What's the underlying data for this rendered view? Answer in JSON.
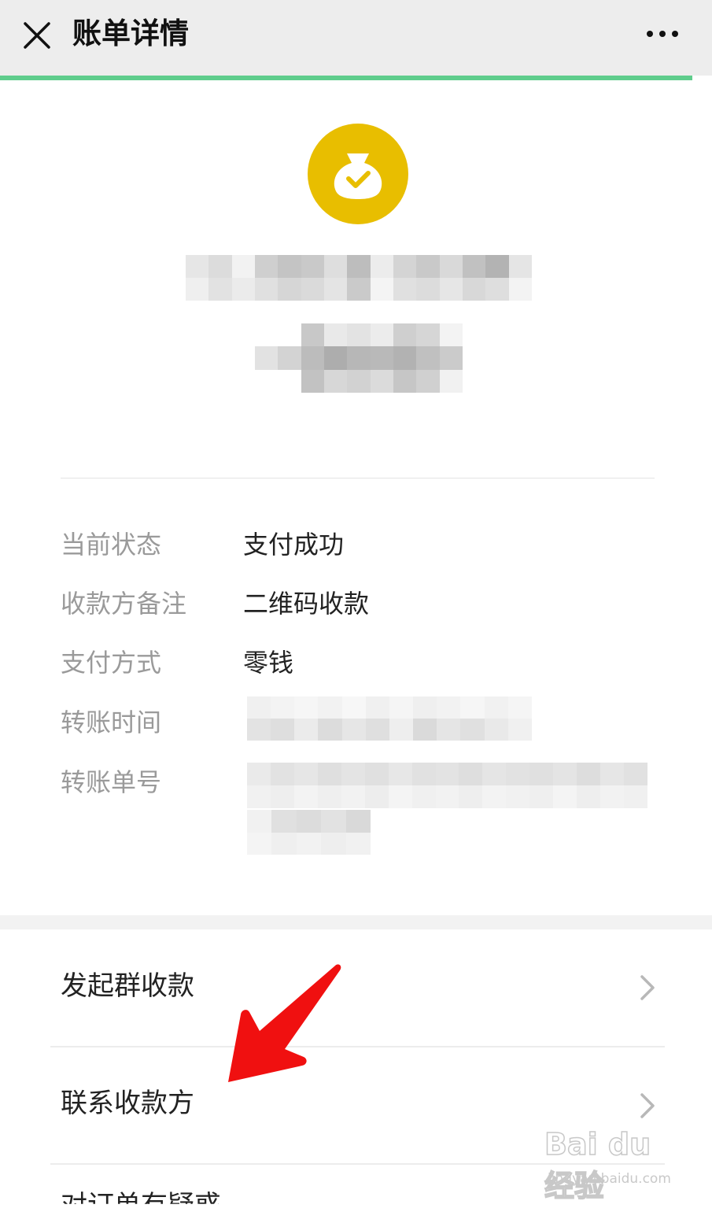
{
  "topbar": {
    "title": "账单详情"
  },
  "icons": {
    "close": "close-icon",
    "more": "more-icon",
    "money_bag": "money-bag-check-icon",
    "chevron": "chevron-right-icon"
  },
  "colors": {
    "accent_progress": "#5fcd8c",
    "bag_circle": "#e8be00",
    "arrow": "#f01010"
  },
  "details": [
    {
      "label": "当前状态",
      "value": "支付成功"
    },
    {
      "label": "收款方备注",
      "value": "二维码收款"
    },
    {
      "label": "支付方式",
      "value": "零钱"
    },
    {
      "label": "转账时间",
      "value": ""
    },
    {
      "label": "转账单号",
      "value": ""
    }
  ],
  "menu": [
    {
      "label": "发起群收款"
    },
    {
      "label": "联系收款方"
    },
    {
      "label": "对订单有疑惑"
    }
  ],
  "watermark": {
    "main": "Bai du 经验",
    "sub": "jingyan.baidu.com"
  }
}
